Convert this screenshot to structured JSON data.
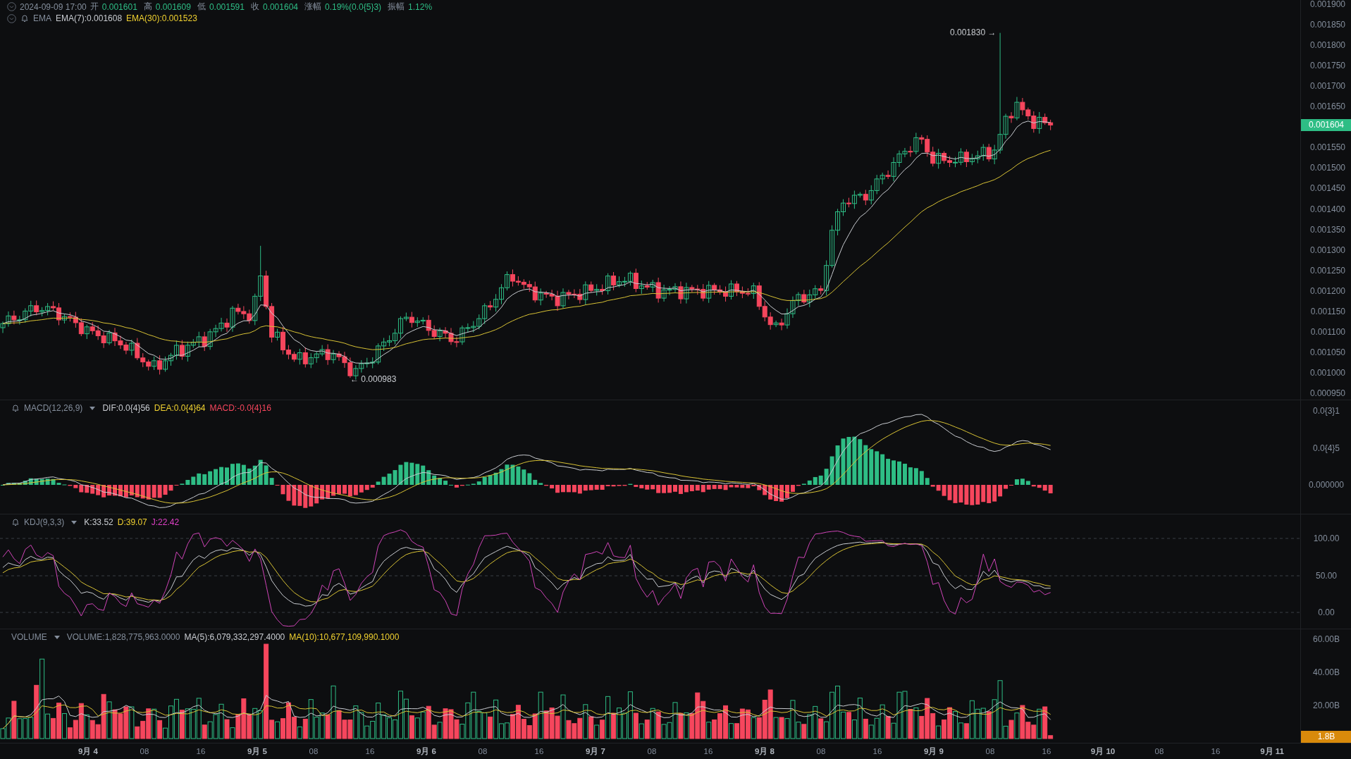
{
  "header": {
    "datetime": "2024-09-09 17:00",
    "fields": [
      {
        "label": "开",
        "value": "0.001601"
      },
      {
        "label": "高",
        "value": "0.001609"
      },
      {
        "label": "低",
        "value": "0.001591"
      },
      {
        "label": "收",
        "value": "0.001604"
      },
      {
        "label": "涨幅",
        "value": "0.19%(0.0{5}3)"
      },
      {
        "label": "振幅",
        "value": "1.12%"
      }
    ]
  },
  "main_indicator": {
    "name": "EMA",
    "values": [
      {
        "text": "EMA(7):0.001608",
        "kind": "white"
      },
      {
        "text": "EMA(30):0.001523",
        "kind": "yellow"
      }
    ]
  },
  "price_chart": {
    "yticks": [
      "0.001900",
      "0.001850",
      "0.001800",
      "0.001750",
      "0.001700",
      "0.001650",
      "0.001550",
      "0.001500",
      "0.001450",
      "0.001400",
      "0.001350",
      "0.001300",
      "0.001250",
      "0.001200",
      "0.001150",
      "0.001100",
      "0.001050",
      "0.001000",
      "0.000950"
    ],
    "last_price": "0.001604",
    "high_marker": "0.001830 →",
    "low_marker": "← 0.000983"
  },
  "macd": {
    "name": "MACD(12,26,9)",
    "values": [
      {
        "text": "DIF:0.0{4}56",
        "kind": "white"
      },
      {
        "text": "DEA:0.0{4}64",
        "kind": "yellow"
      },
      {
        "text": "MACD:-0.0{4}16",
        "kind": "red"
      }
    ],
    "yticks": [
      "0.0{3}1",
      "0.0{4}5",
      "0.000000"
    ]
  },
  "kdj": {
    "name": "KDJ(9,3,3)",
    "values": [
      {
        "text": "K:33.52",
        "kind": "white"
      },
      {
        "text": "D:39.07",
        "kind": "yellow"
      },
      {
        "text": "J:22.42",
        "kind": "magenta"
      }
    ],
    "yticks": [
      "100.00",
      "50.00",
      "0.00"
    ]
  },
  "volume": {
    "name": "VOLUME",
    "values": [
      {
        "text": "VOLUME:1,828,775,963.0000",
        "kind": "grey"
      },
      {
        "text": "MA(5):6,079,332,297.4000",
        "kind": "white"
      },
      {
        "text": "MA(10):10,677,109,990.1000",
        "kind": "yellow"
      }
    ],
    "yticks": [
      "60.00B",
      "40.00B",
      "20.00B"
    ],
    "last_volume": "1.8B"
  },
  "time_axis": [
    {
      "label": "9月 4",
      "kind": "day"
    },
    {
      "label": "08",
      "kind": "hour"
    },
    {
      "label": "16",
      "kind": "hour"
    },
    {
      "label": "9月 5",
      "kind": "day"
    },
    {
      "label": "08",
      "kind": "hour"
    },
    {
      "label": "16",
      "kind": "hour"
    },
    {
      "label": "9月 6",
      "kind": "day"
    },
    {
      "label": "08",
      "kind": "hour"
    },
    {
      "label": "16",
      "kind": "hour"
    },
    {
      "label": "9月 7",
      "kind": "day"
    },
    {
      "label": "08",
      "kind": "hour"
    },
    {
      "label": "16",
      "kind": "hour"
    },
    {
      "label": "9月 8",
      "kind": "day"
    },
    {
      "label": "08",
      "kind": "hour"
    },
    {
      "label": "16",
      "kind": "hour"
    },
    {
      "label": "9月 9",
      "kind": "day"
    },
    {
      "label": "08",
      "kind": "hour"
    },
    {
      "label": "16",
      "kind": "hour"
    },
    {
      "label": "9月 10",
      "kind": "day"
    },
    {
      "label": "08",
      "kind": "hour"
    },
    {
      "label": "16",
      "kind": "hour"
    },
    {
      "label": "9月 11",
      "kind": "day"
    }
  ]
}
